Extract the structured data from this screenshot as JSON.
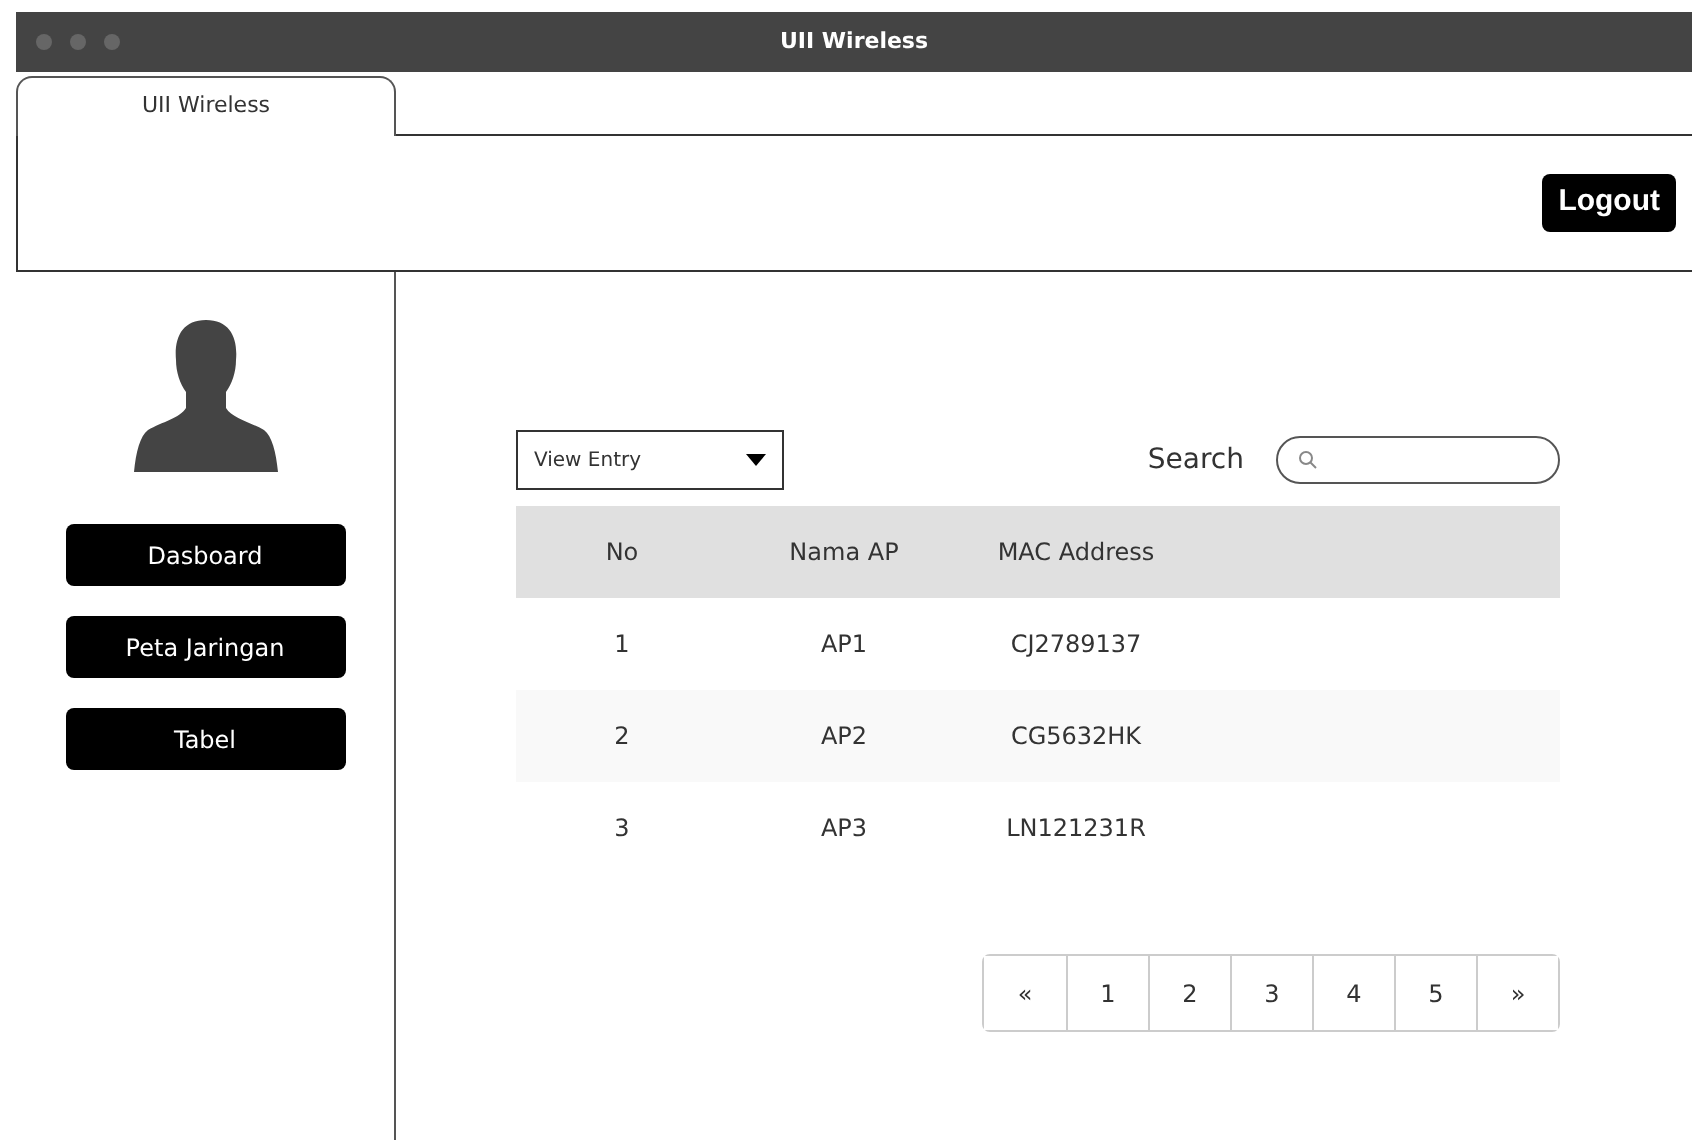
{
  "window": {
    "title": "UII Wireless"
  },
  "tab": {
    "label": "UII Wireless"
  },
  "header": {
    "logout": "Logout"
  },
  "sidebar": {
    "items": [
      {
        "label": "Dasboard"
      },
      {
        "label": "Peta Jaringan"
      },
      {
        "label": "Tabel"
      }
    ]
  },
  "toolbar": {
    "entry_select": "View Entry",
    "search_label": "Search"
  },
  "table": {
    "columns": [
      "No",
      "Nama AP",
      "MAC Address"
    ],
    "rows": [
      [
        "1",
        "AP1",
        "CJ2789137"
      ],
      [
        "2",
        "AP2",
        "CG5632HK"
      ],
      [
        "3",
        "AP3",
        "LN121231R"
      ]
    ]
  },
  "pagination": [
    "«",
    "1",
    "2",
    "3",
    "4",
    "5",
    "»"
  ]
}
